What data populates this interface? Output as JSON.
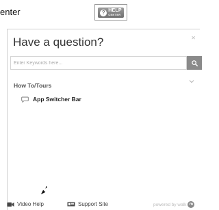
{
  "top": {
    "partial_text": "enter",
    "help_button": {
      "line1": "HELP",
      "line2": "CENTER",
      "icon": "question-circle-icon"
    }
  },
  "panel": {
    "title": "Have a question?",
    "close_icon": "close-icon",
    "search": {
      "placeholder": "Enter Keywords here...",
      "value": "",
      "button_icon": "search-icon"
    },
    "section": {
      "title": "How To/Tours",
      "icon": "chevron-down-icon"
    },
    "items": [
      {
        "label": "App Switcher Bar",
        "icon": "chat-bubble-icon"
      }
    ]
  },
  "footer": {
    "video_help": "Video Help",
    "support_site": "Support Site",
    "powered_by": "powered by walk",
    "brand_badge": "m"
  },
  "colors": {
    "button_gray": "#8a8a8a",
    "panel_border": "#cfcfcf",
    "title_text": "#333333"
  }
}
